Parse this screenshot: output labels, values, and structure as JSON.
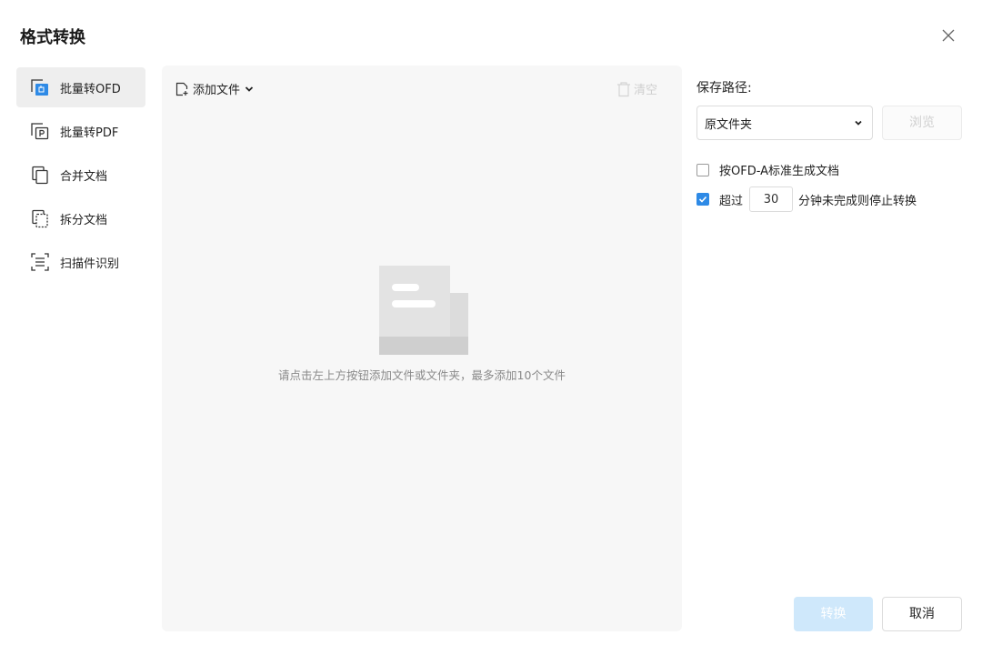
{
  "dialog": {
    "title": "格式转换"
  },
  "sidebar": {
    "items": [
      {
        "label": "批量转OFD",
        "icon": "ofd-convert-icon",
        "active": true
      },
      {
        "label": "批量转PDF",
        "icon": "pdf-convert-icon",
        "active": false
      },
      {
        "label": "合并文档",
        "icon": "merge-docs-icon",
        "active": false
      },
      {
        "label": "拆分文档",
        "icon": "split-docs-icon",
        "active": false
      },
      {
        "label": "扫描件识别",
        "icon": "scan-recognize-icon",
        "active": false
      }
    ]
  },
  "file_panel": {
    "add_file_label": "添加文件",
    "clear_label": "清空",
    "empty_hint": "请点击左上方按钮添加文件或文件夹，最多添加10个文件"
  },
  "settings": {
    "save_path_label": "保存路径:",
    "save_path_value": "原文件夹",
    "browse_label": "浏览",
    "ofda_label": "按OFD-A标准生成文档",
    "ofda_checked": false,
    "timeout_prefix": "超过",
    "timeout_minutes": "30",
    "timeout_suffix": "分钟未完成则停止转换",
    "timeout_checked": true
  },
  "footer": {
    "convert_label": "转换",
    "cancel_label": "取消"
  },
  "colors": {
    "accent": "#2e8ae6",
    "convert_disabled_bg": "#cfe8fb",
    "panel_bg": "#f7f7f7",
    "active_item_bg": "#eeeeee"
  }
}
